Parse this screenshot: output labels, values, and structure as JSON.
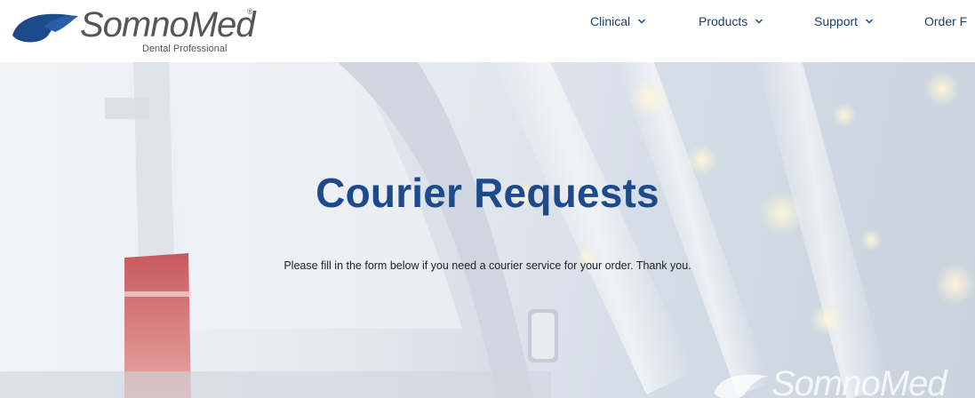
{
  "brand": {
    "name": "SomnoMed",
    "registered_mark": "®",
    "tagline": "Dental Professional",
    "primary_color": "#1c4a8a",
    "logo_icon": "somnomed-swoosh-logo"
  },
  "nav": {
    "items": [
      {
        "label": "Clinical",
        "icon": "chevron-down-icon"
      },
      {
        "label": "Products",
        "icon": "chevron-down-icon"
      },
      {
        "label": "Support",
        "icon": "chevron-down-icon"
      },
      {
        "label": "Order F"
      }
    ]
  },
  "hero": {
    "title": "Courier Requests",
    "description": "Please fill in the form below if you need a courier service for your order. Thank you.",
    "watermark_text": "SomnoMed"
  }
}
